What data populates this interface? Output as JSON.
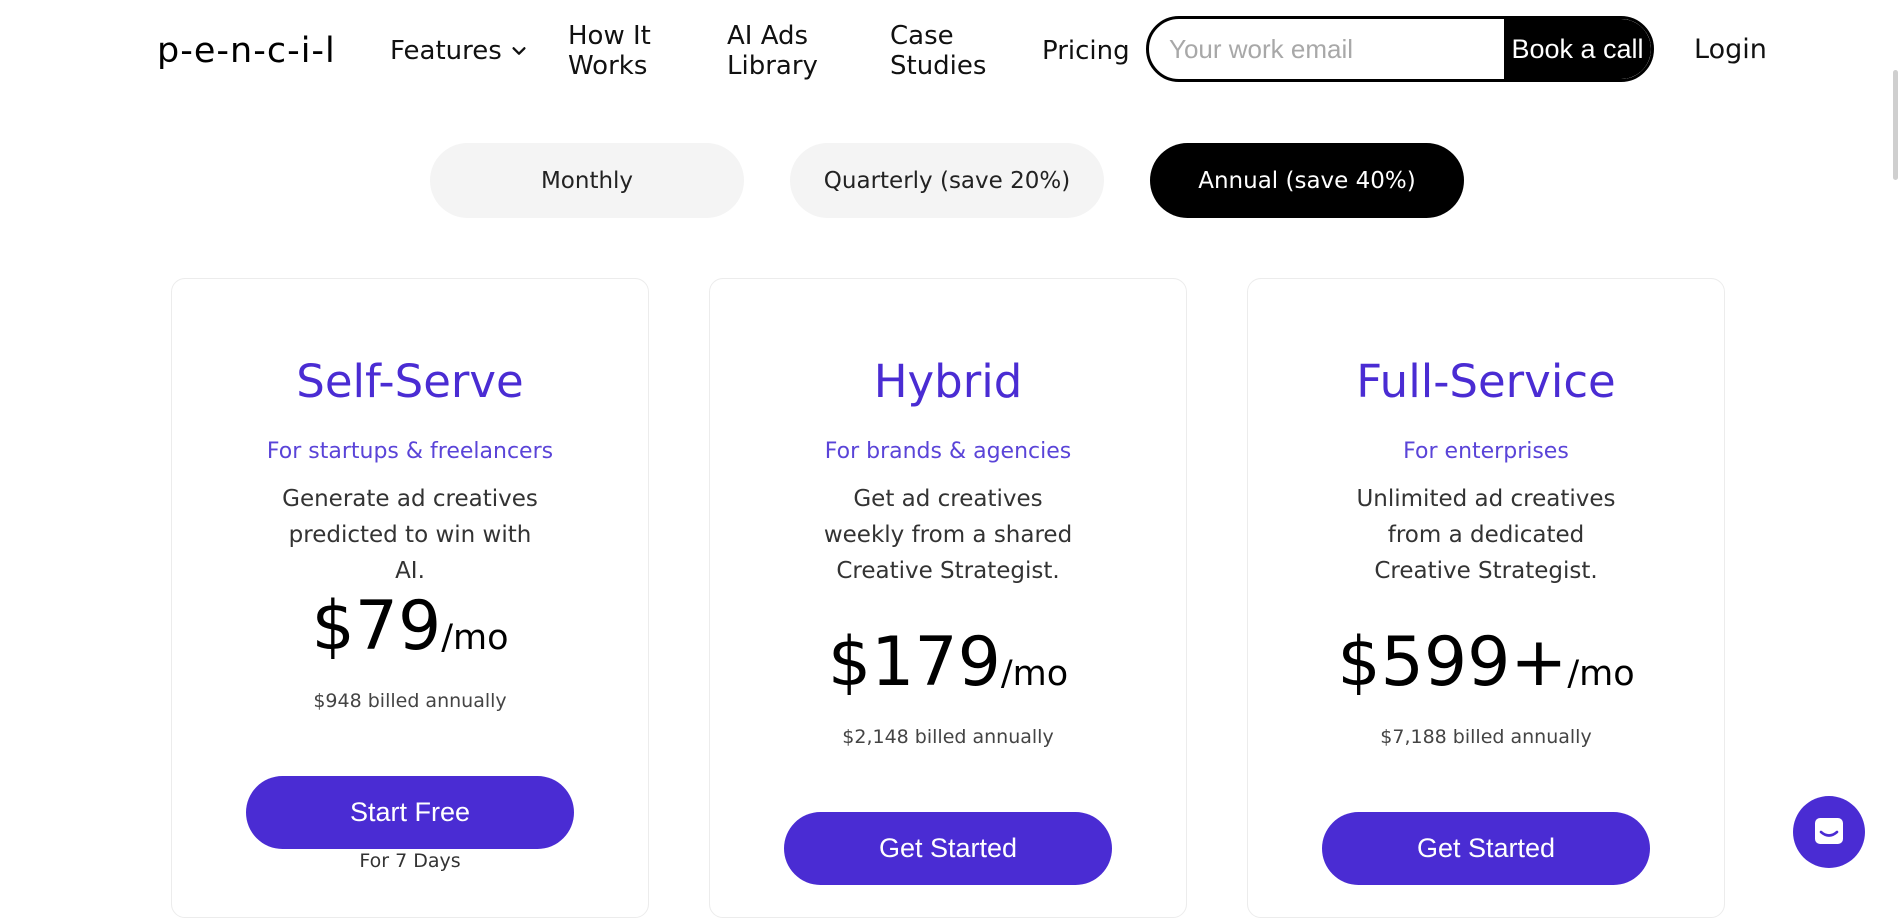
{
  "header": {
    "logo_text": "p-e-n-c-i-l",
    "nav": {
      "features": "Features",
      "how_it_works_line1": "How It",
      "how_it_works_line2": "Works",
      "ai_ads_line1": "AI Ads",
      "ai_ads_line2": "Library",
      "case_line1": "Case",
      "case_line2": "Studies",
      "pricing": "Pricing"
    },
    "email_placeholder": "Your work email",
    "book_call": "Book a call",
    "login": "Login"
  },
  "billing_toggle": {
    "monthly": "Monthly",
    "quarterly": "Quarterly (save 20%)",
    "annual": "Annual (save 40%)",
    "selected": "annual"
  },
  "plans": [
    {
      "name": "Self-Serve",
      "audience": "For startups & freelancers",
      "description": "Generate ad creatives predicted to win with AI.",
      "price": "$79",
      "unit": "/mo",
      "billed": "$948 billed annually",
      "cta": "Start Free",
      "note": "For 7 Days"
    },
    {
      "name": "Hybrid",
      "audience": "For brands & agencies",
      "description": "Get ad creatives weekly from a shared Creative Strategist.",
      "price": "$179",
      "unit": "/mo",
      "billed": "$2,148 billed annually",
      "cta": "Get Started"
    },
    {
      "name": "Full-Service",
      "audience": "For enterprises",
      "description": "Unlimited ad creatives from a dedicated Creative Strategist.",
      "price": "$599+",
      "unit": "/mo",
      "billed": "$7,188 billed annually",
      "cta": "Get Started"
    }
  ],
  "colors": {
    "accent": "#4a2cd3",
    "dark": "#000000",
    "toggle_bg": "#f4f4f4"
  },
  "icons": {
    "features_dropdown": "chevron-down-icon",
    "chat": "chat-bubble-icon"
  }
}
